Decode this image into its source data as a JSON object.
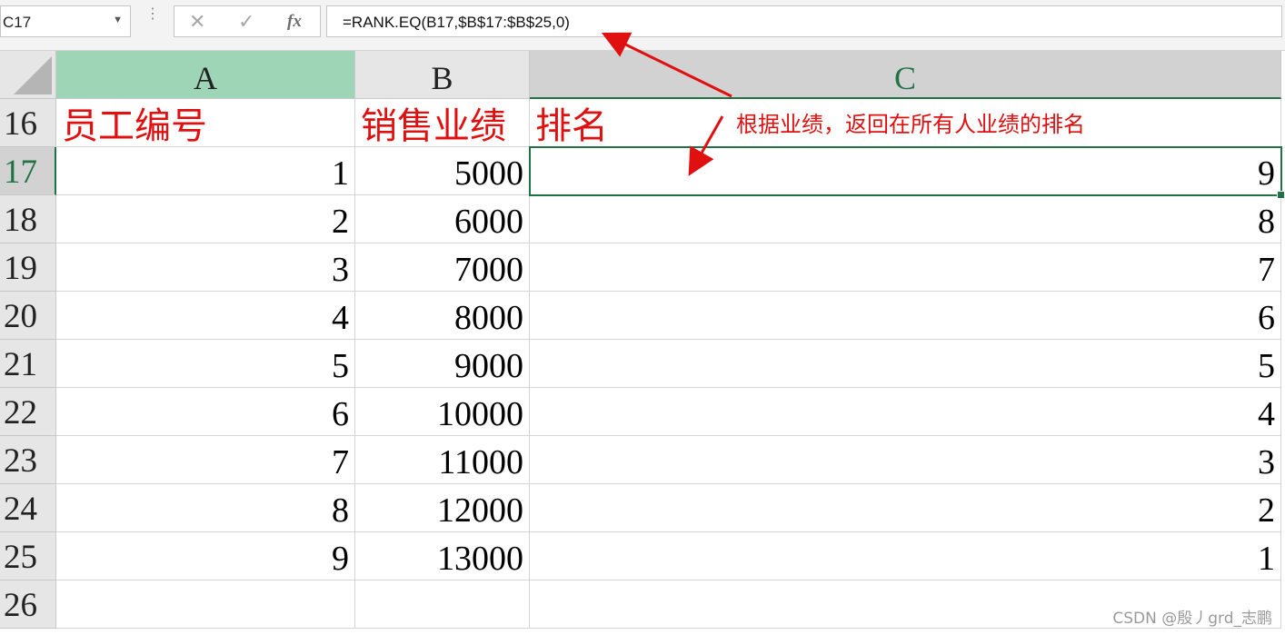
{
  "formula_bar": {
    "name_box": "C17",
    "formula": "=RANK.EQ(B17,$B$17:$B$25,0)",
    "fx_label": "fx",
    "cancel_glyph": "✕",
    "confirm_glyph": "✓",
    "dots": "⋮"
  },
  "columns": [
    "A",
    "B",
    "C"
  ],
  "header_row": {
    "number": "16",
    "a": "员工编号",
    "b": "销售业绩",
    "c": "排名"
  },
  "rows": [
    {
      "number": "17",
      "a": "1",
      "b": "5000",
      "c": "9"
    },
    {
      "number": "18",
      "a": "2",
      "b": "6000",
      "c": "8"
    },
    {
      "number": "19",
      "a": "3",
      "b": "7000",
      "c": "7"
    },
    {
      "number": "20",
      "a": "4",
      "b": "8000",
      "c": "6"
    },
    {
      "number": "21",
      "a": "5",
      "b": "9000",
      "c": "5"
    },
    {
      "number": "22",
      "a": "6",
      "b": "10000",
      "c": "4"
    },
    {
      "number": "23",
      "a": "7",
      "b": "11000",
      "c": "3"
    },
    {
      "number": "24",
      "a": "8",
      "b": "12000",
      "c": "2"
    },
    {
      "number": "25",
      "a": "9",
      "b": "13000",
      "c": "1"
    }
  ],
  "empty_row": {
    "number": "26"
  },
  "selected_row": "17",
  "annotation": "根据业绩，返回在所有人业绩的排名",
  "watermark": "CSDN @殷丿grd_志鹏",
  "colors": {
    "accent_green": "#217346",
    "header_red": "#e01010",
    "selected_col_fill": "#9fd5b7"
  }
}
